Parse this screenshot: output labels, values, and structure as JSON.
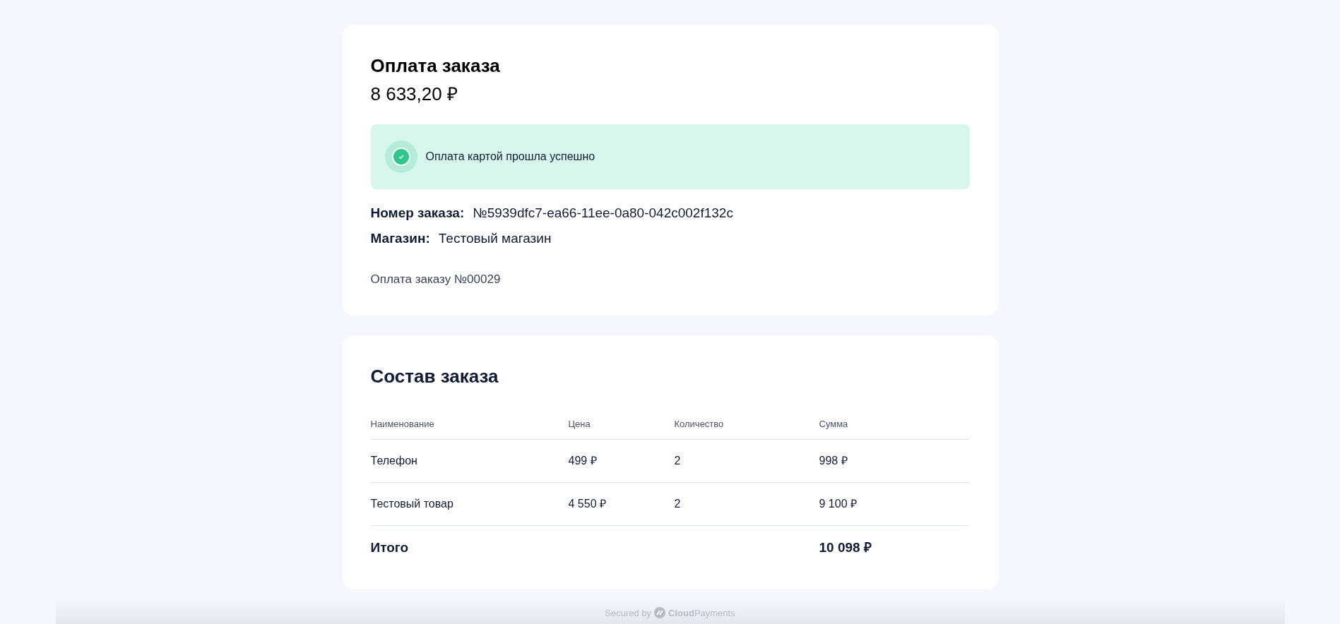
{
  "payment": {
    "title": "Оплата заказа",
    "amount": "8 633,20 ₽",
    "status": {
      "kind": "success",
      "text": "Оплата картой прошла успешно"
    },
    "details": [
      {
        "label": "Номер заказа:",
        "value": "№5939dfc7-ea66-11ee-0a80-042c002f132c"
      },
      {
        "label": "Магазин:",
        "value": "Тестовый магазин"
      }
    ],
    "description": "Оплата заказу №00029"
  },
  "order": {
    "title": "Состав заказа",
    "columns": [
      "Наименование",
      "Цена",
      "Количество",
      "Сумма"
    ],
    "rows": [
      [
        "Телефон",
        "499 ₽",
        "2",
        "998 ₽"
      ],
      [
        "Тестовый товар",
        "4 550 ₽",
        "2",
        "9 100 ₽"
      ]
    ],
    "total": {
      "label": "Итого",
      "value": "10 098 ₽"
    }
  },
  "footer": {
    "secured": "Secured by",
    "brand": "**Cloud**Payments"
  }
}
